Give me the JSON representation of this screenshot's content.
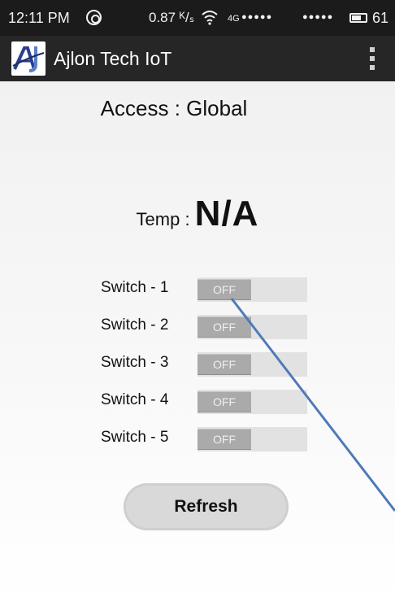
{
  "status_bar": {
    "time": "12:11 PM",
    "speed": "0.87 ᴷ/ₛ",
    "network": "4G",
    "signal_dots_1": "●●●●●",
    "signal_dots_2": "●●●●●",
    "battery": "61"
  },
  "app_bar": {
    "title": "Ajlon Tech IoT",
    "logo_icon": "aj-logo-icon",
    "overflow_icon": "more-vert-icon"
  },
  "access": {
    "label": "Access : Global"
  },
  "temperature": {
    "label": "Temp : ",
    "value": "N/A"
  },
  "switches": [
    {
      "label": "Switch - 1",
      "state": "OFF"
    },
    {
      "label": "Switch - 2",
      "state": "OFF"
    },
    {
      "label": "Switch - 3",
      "state": "OFF"
    },
    {
      "label": "Switch - 4",
      "state": "OFF"
    },
    {
      "label": "Switch - 5",
      "state": "OFF"
    }
  ],
  "refresh_button": {
    "label": "Refresh"
  },
  "colors": {
    "status_bar_bg": "#1b1b1b",
    "app_bar_bg": "#262626",
    "toggle_off": "#aaaaaa",
    "annotation_line": "#4f7ab8"
  }
}
